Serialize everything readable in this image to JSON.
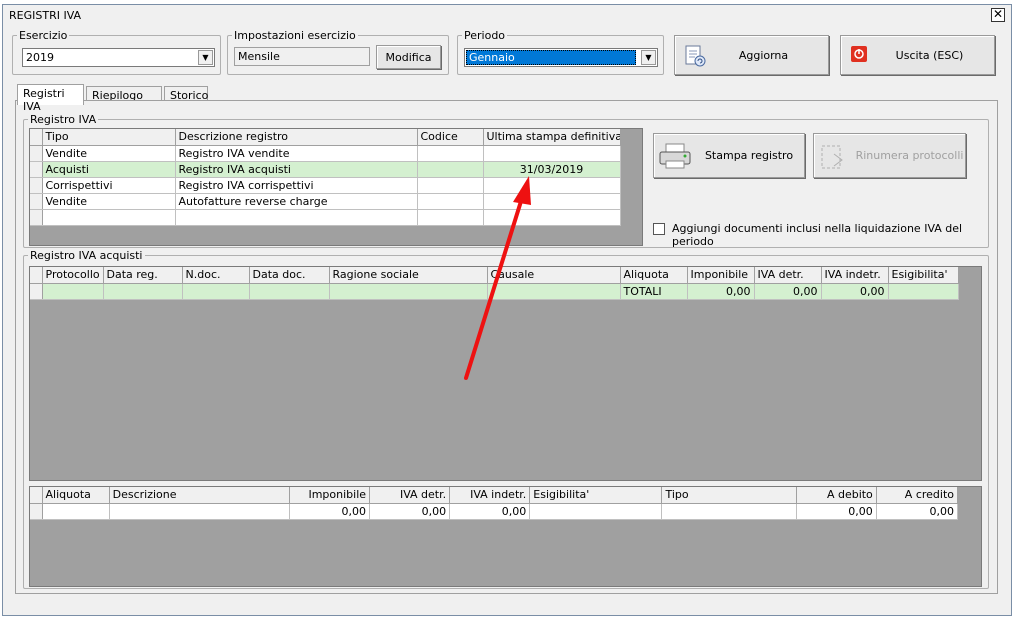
{
  "window": {
    "title": "REGISTRI IVA",
    "close": "✕"
  },
  "esercizio": {
    "legend": "Esercizio",
    "value": "2019"
  },
  "impostazioni": {
    "legend": "Impostazioni esercizio",
    "value": "Mensile",
    "button": "Modifica"
  },
  "periodo": {
    "legend": "Periodo",
    "value": "Gennaio"
  },
  "buttons": {
    "aggiorna": "Aggiorna",
    "uscita": "Uscita (ESC)",
    "stampa": "Stampa registro",
    "rinumera": "Rinumera protocolli"
  },
  "tabs": [
    "Registri IVA",
    "Riepilogo IVA",
    "Storico"
  ],
  "registro_iva": {
    "legend": "Registro IVA",
    "columns": [
      "Tipo",
      "Descrizione registro",
      "Codice",
      "Ultima stampa definitiva"
    ],
    "rows": [
      [
        "Vendite",
        "Registro IVA vendite",
        "",
        ""
      ],
      [
        "Acquisti",
        "Registro IVA acquisti",
        "",
        "31/03/2019"
      ],
      [
        "Corrispettivi",
        "Registro IVA corrispettivi",
        "",
        ""
      ],
      [
        "Vendite",
        "Autofatture reverse charge",
        "",
        ""
      ],
      [
        "",
        "",
        "",
        ""
      ]
    ]
  },
  "checkbox_label": "Aggiungi documenti inclusi nella liquidazione IVA del periodo",
  "acquisti": {
    "legend": "Registro IVA acquisti",
    "columns": [
      "Protocollo",
      "Data reg.",
      "N.doc.",
      "Data doc.",
      "Ragione sociale",
      "Causale",
      "Aliquota",
      "Imponibile",
      "IVA detr.",
      "IVA indetr.",
      "Esigibilita'"
    ],
    "total_row": [
      "",
      "",
      "",
      "",
      "",
      "",
      "TOTALI",
      "0,00",
      "0,00",
      "0,00",
      ""
    ]
  },
  "riepilogo": {
    "columns": [
      "Aliquota",
      "Descrizione",
      "Imponibile",
      "IVA detr.",
      "IVA indetr.",
      "Esigibilita'",
      "Tipo",
      "A debito",
      "A credito"
    ],
    "row": [
      "",
      "",
      "0,00",
      "0,00",
      "0,00",
      "",
      "",
      "0,00",
      "0,00"
    ]
  },
  "colors": {
    "highlight_row": "#d4f0d0",
    "arrow": "#ee1111",
    "selection": "#0078d7"
  }
}
